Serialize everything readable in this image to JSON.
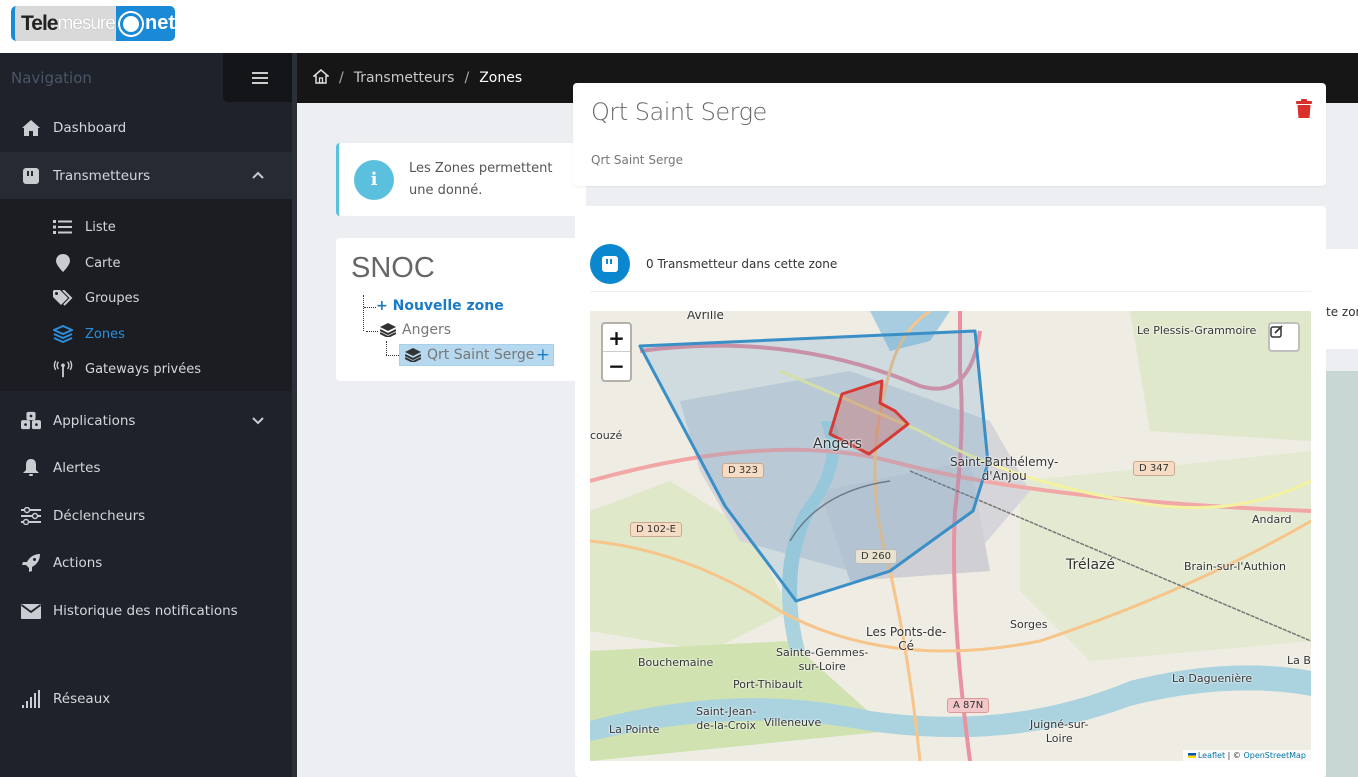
{
  "brand": {
    "part1": "Tele",
    "part2": "mesure",
    "part3": "net"
  },
  "sidebar": {
    "title": "Navigation",
    "items": [
      {
        "label": "Dashboard",
        "icon": "home-icon"
      },
      {
        "label": "Transmetteurs",
        "icon": "device-icon",
        "expanded": true
      },
      {
        "label": "Applications",
        "icon": "cubes-icon",
        "expanded": false
      },
      {
        "label": "Alertes",
        "icon": "bell-icon"
      },
      {
        "label": "Déclencheurs",
        "icon": "sliders-icon"
      },
      {
        "label": "Actions",
        "icon": "rocket-icon"
      },
      {
        "label": "Historique des notifications",
        "icon": "envelope-icon"
      },
      {
        "label": "Réseaux",
        "icon": "signal-icon"
      }
    ],
    "subitems": [
      {
        "label": "Liste",
        "icon": "list-icon"
      },
      {
        "label": "Carte",
        "icon": "map-marker-icon"
      },
      {
        "label": "Groupes",
        "icon": "tags-icon"
      },
      {
        "label": "Zones",
        "icon": "layers-icon",
        "active": true
      },
      {
        "label": "Gateways privées",
        "icon": "antenna-icon"
      }
    ]
  },
  "breadcrumb": {
    "items": [
      "Transmetteurs",
      "Zones"
    ],
    "separator": "/"
  },
  "info": {
    "text": "Les Zones permettent une donné."
  },
  "tree": {
    "title": "SNOC",
    "new_zone": "Nouvelle zone",
    "parent": "Angers",
    "selected": "Qrt Saint Serge"
  },
  "zone": {
    "title": "Qrt Saint Serge",
    "subtitle": "Qrt Saint Serge",
    "stat_text": "0 Transmetteur dans cette zone",
    "peek_text": "te zon"
  },
  "map": {
    "zoom_in": "+",
    "zoom_out": "−",
    "attribution_leaflet": "Leaflet",
    "attribution_sep": " | © ",
    "attribution_osm": "OpenStreetMap",
    "colors": {
      "zone_selected": "#d63a35",
      "zone_parent": "#3b8fc7"
    },
    "labels": [
      {
        "id": "avrille",
        "text": "Avrillé"
      },
      {
        "id": "angers",
        "text": "Angers"
      },
      {
        "id": "plessis",
        "text": "Le Plessis-Grammoire"
      },
      {
        "id": "stbarth",
        "text": "Saint-Barthélemy-\nd'Anjou"
      },
      {
        "id": "trelaze",
        "text": "Trélazé"
      },
      {
        "id": "andard",
        "text": "Andard"
      },
      {
        "id": "brain",
        "text": "Brain-sur-l'Authion"
      },
      {
        "id": "ponts",
        "text": "Les Ponts-de-\nCé"
      },
      {
        "id": "sorges",
        "text": "Sorges"
      },
      {
        "id": "bouchemaine",
        "text": "Bouchemaine"
      },
      {
        "id": "stegemmes",
        "text": "Sainte-Gemmes-\nsur-Loire"
      },
      {
        "id": "portthibault",
        "text": "Port-Thibault"
      },
      {
        "id": "stjean",
        "text": "Saint-Jean-\nde-la-Croix"
      },
      {
        "id": "villeneuve",
        "text": "Villeneuve"
      },
      {
        "id": "lapointe",
        "text": "La Pointe"
      },
      {
        "id": "daguen",
        "text": "La Daguenière"
      },
      {
        "id": "labo",
        "text": "La Bo"
      },
      {
        "id": "beaucouze",
        "text": "couzé"
      },
      {
        "id": "juigne",
        "text": "Juigné-sur-\nLoire"
      }
    ],
    "shields": [
      {
        "id": "d323",
        "text": "D 323"
      },
      {
        "id": "d102e",
        "text": "D 102-E"
      },
      {
        "id": "d260",
        "text": "D 260"
      },
      {
        "id": "d347",
        "text": "D 347"
      },
      {
        "id": "a87n",
        "text": "A 87N"
      }
    ]
  }
}
